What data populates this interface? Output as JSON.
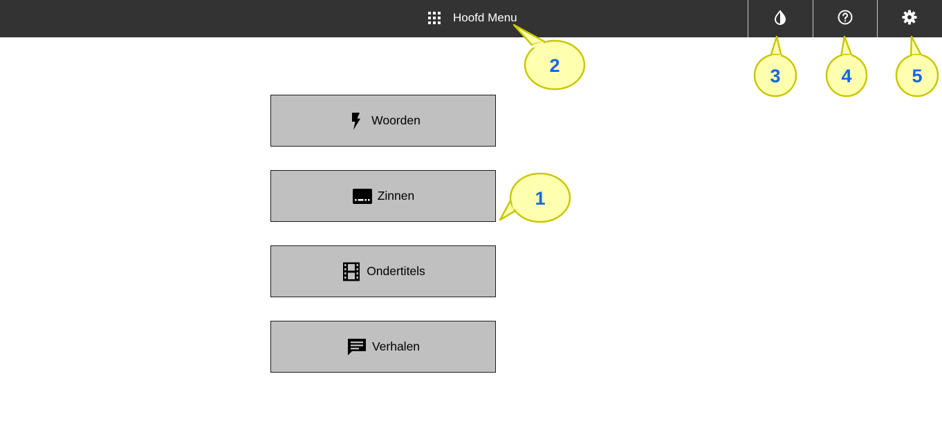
{
  "header": {
    "title": "Hoofd Menu",
    "title_icon": "apps-grid-icon",
    "actions": [
      {
        "name": "contrast",
        "icon": "contrast-drop-icon"
      },
      {
        "name": "help",
        "icon": "help-circle-icon"
      },
      {
        "name": "settings",
        "icon": "gear-icon"
      }
    ]
  },
  "menu": {
    "items": [
      {
        "label": "Woorden",
        "icon": "lightning-bolt-icon"
      },
      {
        "label": "Zinnen",
        "icon": "subtitles-icon"
      },
      {
        "label": "Ondertitels",
        "icon": "film-strip-icon"
      },
      {
        "label": "Verhalen",
        "icon": "chat-bubble-icon"
      }
    ]
  },
  "callouts": [
    "1",
    "2",
    "3",
    "4",
    "5"
  ],
  "colors": {
    "topbar": "#333333",
    "button_bg": "#c0c0c0",
    "callout_fill": "#ffffb0",
    "callout_stroke": "#c8c800",
    "callout_text": "#1565e6"
  }
}
